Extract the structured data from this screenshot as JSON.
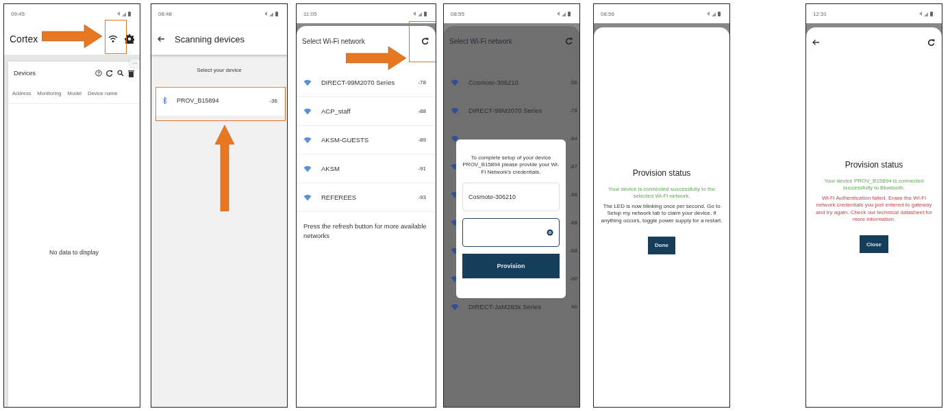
{
  "screens": [
    {
      "kind": "devices",
      "time": "09:45",
      "title": "Cortex",
      "card_title": "Devices",
      "columns": [
        "Address",
        "Monitoring",
        "Model",
        "Device name"
      ],
      "more": "...",
      "empty": "No data to display"
    },
    {
      "kind": "scan",
      "time": "08:48",
      "title": "Scanning devices",
      "prompt": "Select your device",
      "devices": [
        {
          "name": "PROV_B15894",
          "rssi": "-36"
        }
      ]
    },
    {
      "kind": "wifi",
      "time": "11:05",
      "title": "Select Wi-Fi network",
      "networks": [
        {
          "name": "DIRECT-99M2070 Series",
          "rssi": "-78"
        },
        {
          "name": "ACP_staff",
          "rssi": "-88"
        },
        {
          "name": "AKSM-GUESTS",
          "rssi": "-89"
        },
        {
          "name": "AKSM",
          "rssi": "-91"
        },
        {
          "name": "REFEREES",
          "rssi": "-93"
        }
      ],
      "hint": "Press the refresh button for more available networks"
    },
    {
      "kind": "credentials",
      "time": "08:55",
      "title": "Select Wi-Fi network",
      "networks": [
        {
          "name": "Cosmote-306210",
          "rssi": "-56"
        },
        {
          "name": "DIRECT-99M2070 Series",
          "rssi": "-78"
        },
        {
          "rssi": "-84"
        },
        {
          "rssi": "-87"
        },
        {
          "rssi": "-88"
        },
        {
          "rssi": "-88"
        },
        {
          "rssi": "-88"
        },
        {
          "rssi": "-90"
        },
        {
          "name": "DIRECT-JaM283x Series",
          "rssi": "90"
        }
      ],
      "dialog": {
        "message": "To complete setup of your device PROV_B15894 please provide your Wi-Fi Network's credentials.",
        "ssid": "Cosmote-306210",
        "button": "Provision"
      }
    },
    {
      "kind": "status",
      "time": "08:56",
      "title": "Provision status",
      "messages": [
        {
          "text": "Your device is connected successfully to the selected Wi-Fi network.",
          "kind": "success"
        },
        {
          "text": "The LED is now blinking once per second. Go to Setup my network tab to claim your device. If anything occurs, toggle power supply for a restart.",
          "kind": "info"
        }
      ],
      "button": "Done"
    },
    {
      "kind": "status",
      "time": "12:31",
      "toolbar": true,
      "title": "Provision status",
      "messages": [
        {
          "text": "Your device PROV_B15894 is connected successfully to Bluetooth.",
          "kind": "success"
        },
        {
          "text": "Wi-Fi Authentication failed. Erase the Wi-Fi network credentials you just entered to gateway and try again. Check our technical datasheet for more information.",
          "kind": "error"
        }
      ],
      "button": "Close"
    }
  ]
}
